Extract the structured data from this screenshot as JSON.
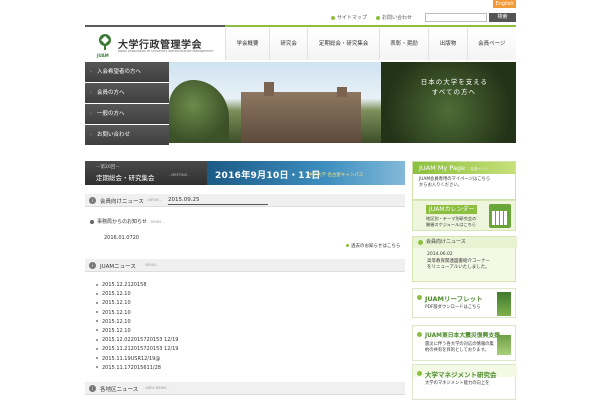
{
  "top": {
    "english_label": "English",
    "links": [
      "サイトマップ",
      "お問い合わせ"
    ],
    "search_button_label": "検索",
    "search_placeholder": ""
  },
  "logo": {
    "name_jp": "大学行政管理学会",
    "name_en": "Japan Association of University Administrative Management",
    "abbr": "JUAM"
  },
  "gnav": {
    "items": [
      "学会概要",
      "研究会",
      "定期総会・研究集会",
      "表彰・奨励",
      "出版物",
      "会員ページ"
    ]
  },
  "side_menu": {
    "items": [
      "入会希望者の方へ",
      "会員の方へ",
      "一般の方へ",
      "お問い合わせ"
    ]
  },
  "hero": {
    "caption_line1": "日本の大学を支える",
    "caption_line2": "すべての方へ"
  },
  "conference": {
    "ordinal": "－第20回－",
    "title": "定期総会・研究集会",
    "badge": "- MEETING -",
    "date": "2016年9月10日・11日",
    "place": "中京大学 名古屋キャンパス"
  },
  "sections": {
    "member_news": {
      "title": "会員向けニュース",
      "sub": "- NEWS -",
      "date": "2015.09.25"
    },
    "office_news": {
      "title": "事務局からのお知らせ",
      "sub": "- NEWS -",
      "date": "2016.01.0720",
      "more": "過去のお知らせはこちら"
    },
    "juam_news": {
      "title": "JUAMニュース",
      "sub": "- NEWS -",
      "items": [
        "2015.12.2120158",
        "2015.12.10",
        "2015.12.10",
        "2015.12.10",
        "2015.12.10",
        "2015.12.10",
        "2015.12.022015720153 12/19",
        "2015.11.212015720153 12/19",
        "2015.11.19USR12/19@",
        "2015.11.172015611/28"
      ]
    },
    "regional": {
      "title": "各地区ニュース",
      "sub": "- AREA NEWS -"
    }
  },
  "right": {
    "mypage": {
      "title": "JUAM My Page",
      "sub": "- 会員ページ -",
      "text_line1": "JUAM会員専用のマイページはこちら",
      "text_line2": "からお入りください。"
    },
    "calendar": {
      "title": "JUAMカレンダー",
      "text_line1": "地区別・テーマ別研究会の",
      "text_line2": "開催スケジュールはこちら"
    },
    "member_news": {
      "title": "会員向けニュース",
      "date": "2014.06.02",
      "text_line1": "高等教育関連図書紹介コーナー",
      "text_line2": "をリニューアルいたしました。"
    },
    "leaflet": {
      "title": "JUAMリーフレット",
      "text": "PDF版ダウンロードはこちら"
    },
    "reconstruct": {
      "title": "JUAM東日本大震災復興支援",
      "text_line1": "震災に伴う各大学の対応の情報の集",
      "text_line2": "約の共有を目的としております。"
    },
    "mgmt": {
      "title": "大学マネジメント研究会",
      "text": "大学のマネジメント能力の向上を"
    }
  },
  "colors": {
    "accent_green": "#8cbf3f",
    "dark_gray": "#4a4a4a",
    "banner_blue": "#3d8fbf",
    "english_orange": "#f29a3a"
  }
}
